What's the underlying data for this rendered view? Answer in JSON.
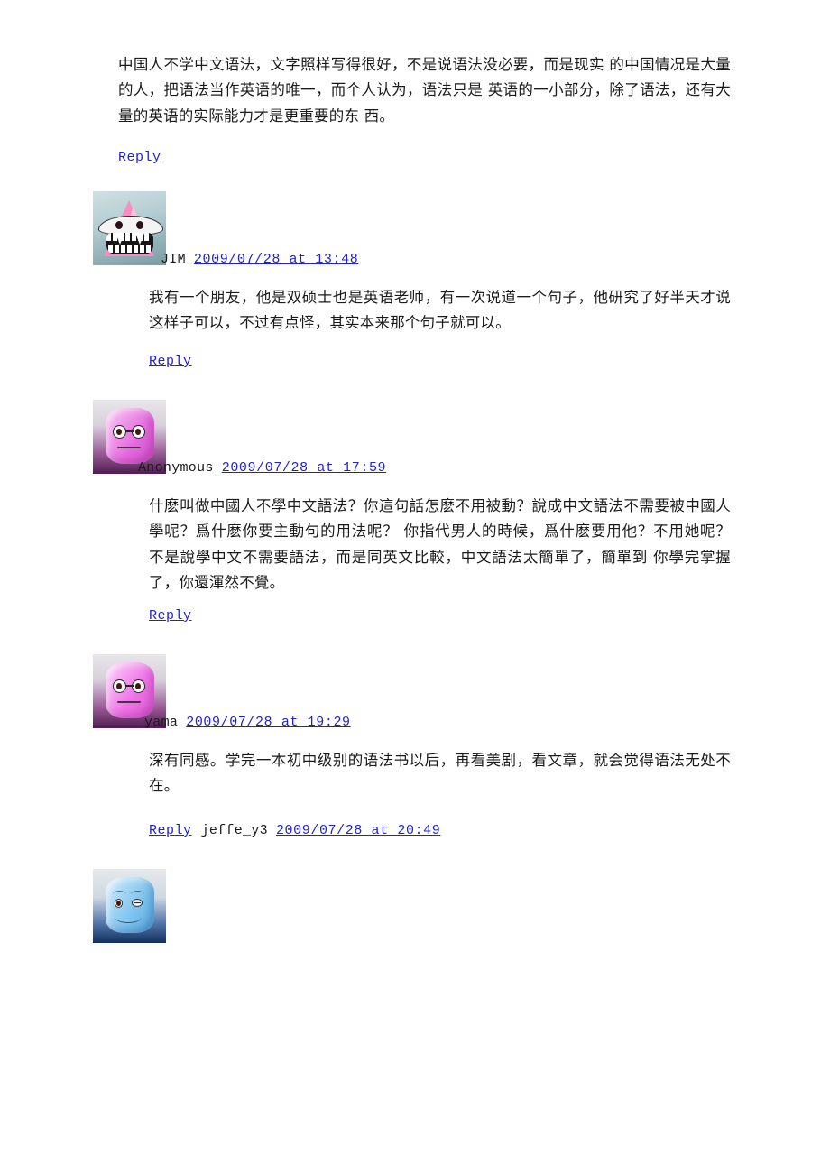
{
  "root_comment": {
    "body": "中国人不学中文语法，文字照样写得很好，不是说语法没必要，而是现实 的中国情况是大量的人，把语法当作英语的唯一，而个人认为，语法只是 英语的一小部分，除了语法，还有大量的英语的实际能力才是更重要的东 西。",
    "reply_label": "Reply"
  },
  "comments": [
    {
      "author": "JIM",
      "date": "2009/07/28 at 13:48",
      "body": "我有一个朋友，他是双硕士也是英语老师，有一次说道一个句子，他研究了好半天才说这样子可以，不过有点怪，其实本来那个句子就可以。",
      "reply_label": "Reply",
      "avatar": "monster-cone-avatar"
    },
    {
      "author": "Anonymous",
      "date": "2009/07/28 at 17:59",
      "body": "什麽叫做中國人不學中文語法？你這句話怎麽不用被動？說成中文語法不需要被中國人學呢？爲什麽你要主動句的用法呢？ 你指代男人的時候，爲什麽要用他？不用她呢？ 不是說學中文不需要語法，而是同英文比較，中文語法太簡單了，簡單到 你學完掌握了，你還渾然不覺。",
      "reply_label": "Reply",
      "avatar": "glasses-face-avatar"
    },
    {
      "author": "yama",
      "date": "2009/07/28 at 19:29",
      "body": "深有同感。学完一本初中级别的语法书以后，再看美剧，看文章，就会觉得语法无处不在。",
      "reply_label": "Reply",
      "avatar": "glasses-face-avatar"
    }
  ],
  "tail": {
    "reply_label": "Reply",
    "author": "jeffe_y3",
    "date": "2009/07/28 at 20:49",
    "avatar": "winking-face-avatar"
  }
}
